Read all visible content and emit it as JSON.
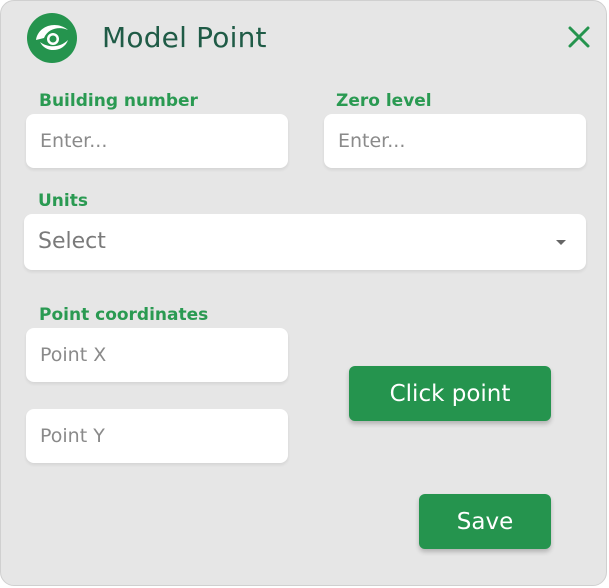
{
  "dialog": {
    "title": "Model Point",
    "logo_icon": "earth-swoosh-logo",
    "close_icon": "close-icon"
  },
  "building_number": {
    "label": "Building number",
    "placeholder": "Enter...",
    "value": ""
  },
  "zero_level": {
    "label": "Zero level",
    "placeholder": "Enter...",
    "value": ""
  },
  "units": {
    "label": "Units",
    "selected": "Select"
  },
  "point_coordinates": {
    "label": "Point coordinates",
    "x_placeholder": "Point X",
    "y_placeholder": "Point Y",
    "x_value": "",
    "y_value": ""
  },
  "buttons": {
    "click_point": "Click point",
    "save": "Save"
  },
  "colors": {
    "accent": "#25944e",
    "label_green": "#2a9a52",
    "title": "#1f5b46",
    "background": "#e6e6e6"
  }
}
